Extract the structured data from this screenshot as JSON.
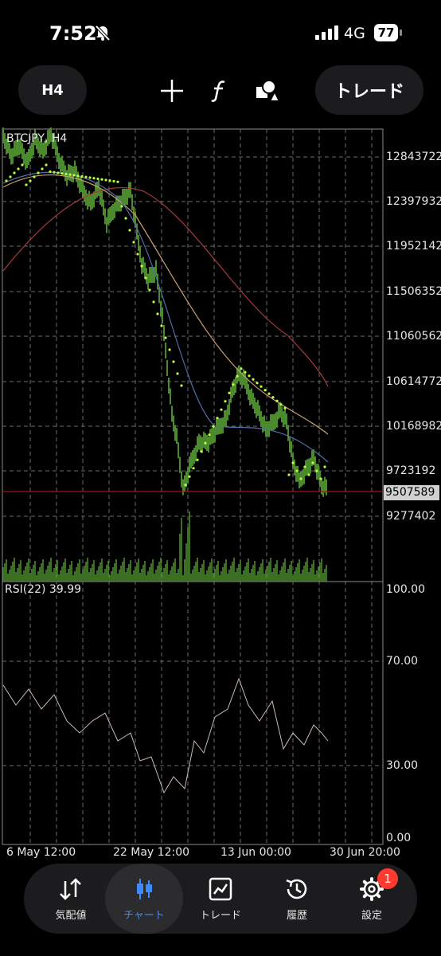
{
  "status_bar": {
    "time": "7:52",
    "network": "4G",
    "battery": "77"
  },
  "toolbar": {
    "timeframe": "H4",
    "trade_label": "トレード"
  },
  "chart": {
    "title": "BTCJPY, H4",
    "price_axis": [
      "12843722",
      "12397932",
      "11952142",
      "11506352",
      "11060562",
      "10614772",
      "10168982",
      "9723192",
      "9277402"
    ],
    "current_price": "9507589",
    "rsi_title": "RSI(22) 39.99",
    "rsi_axis": [
      "100.00",
      "70.00",
      "30.00",
      "0.00"
    ],
    "time_axis": [
      "6 May 12:00",
      "22 May 12:00",
      "13 Jun 00:00",
      "30 Jun 20:00"
    ],
    "colors": {
      "candle": "#4c8a2e",
      "psar": "#b8ff3c",
      "current_line": "#a01818",
      "rsi_line": "#cbb6c4",
      "ma_blue": "#4f6fa8",
      "ma_orange": "#c9a06a",
      "ma_red": "#a83a3a"
    }
  },
  "tabs": [
    {
      "label": "気配値",
      "icon": "quotes-arrows-icon"
    },
    {
      "label": "チャート",
      "icon": "candles-icon"
    },
    {
      "label": "トレード",
      "icon": "trade-chart-icon"
    },
    {
      "label": "履歴",
      "icon": "history-clock-icon"
    },
    {
      "label": "設定",
      "icon": "settings-gear-icon"
    }
  ],
  "settings_badge": "1"
}
